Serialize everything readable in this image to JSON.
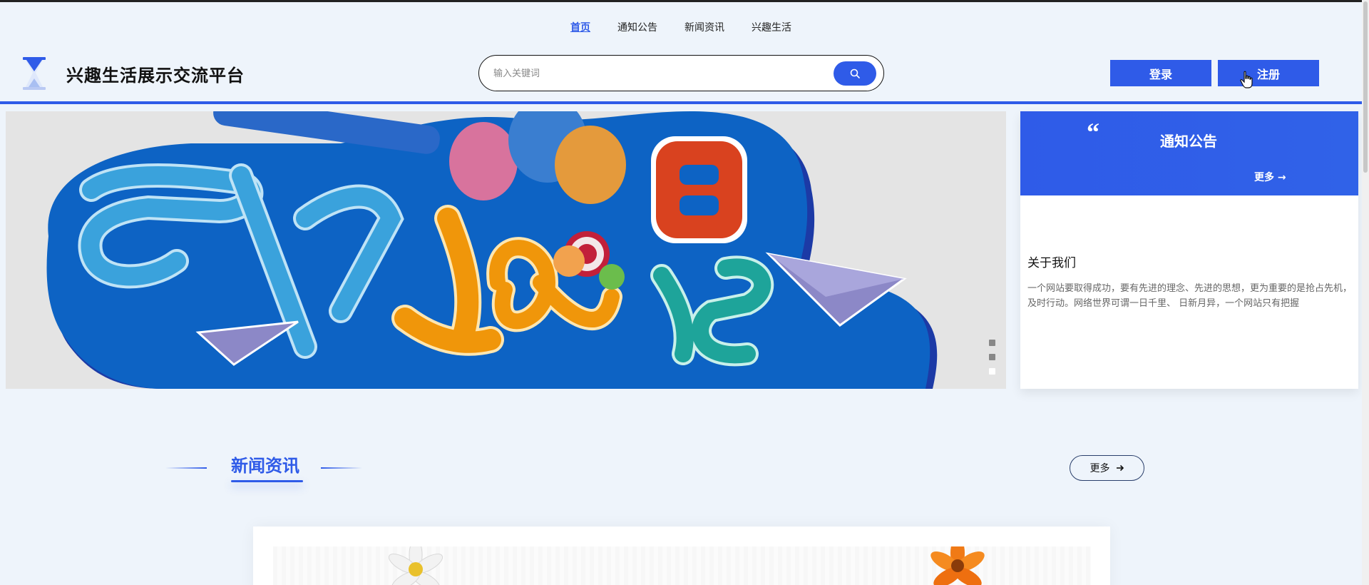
{
  "nav": {
    "items": [
      {
        "label": "首页",
        "active": true
      },
      {
        "label": "通知公告"
      },
      {
        "label": "新闻资讯"
      },
      {
        "label": "兴趣生活"
      }
    ]
  },
  "header": {
    "site_title": "兴趣生活展示交流平台",
    "logo_icon": "hourglass-icon"
  },
  "search": {
    "placeholder": "输入关键词",
    "value": "",
    "icon": "search-icon"
  },
  "auth": {
    "login_label": "登录",
    "register_label": "注册"
  },
  "banner": {
    "slide_count": 3,
    "active_slide": 3
  },
  "notice": {
    "title": "通知公告",
    "quote_mark": "“",
    "more_label": "更多 →"
  },
  "about": {
    "title": "关于我们",
    "text": "一个网站要取得成功，要有先进的理念、先进的思想，更为重要的是抢占先机，及时行动。网络世界可谓一日千里、 日新月异，一个网站只有把握"
  },
  "news_section": {
    "title": "新闻资讯",
    "more_label": "更多"
  },
  "colors": {
    "accent": "#2f5be8",
    "background": "#eef4fb"
  }
}
